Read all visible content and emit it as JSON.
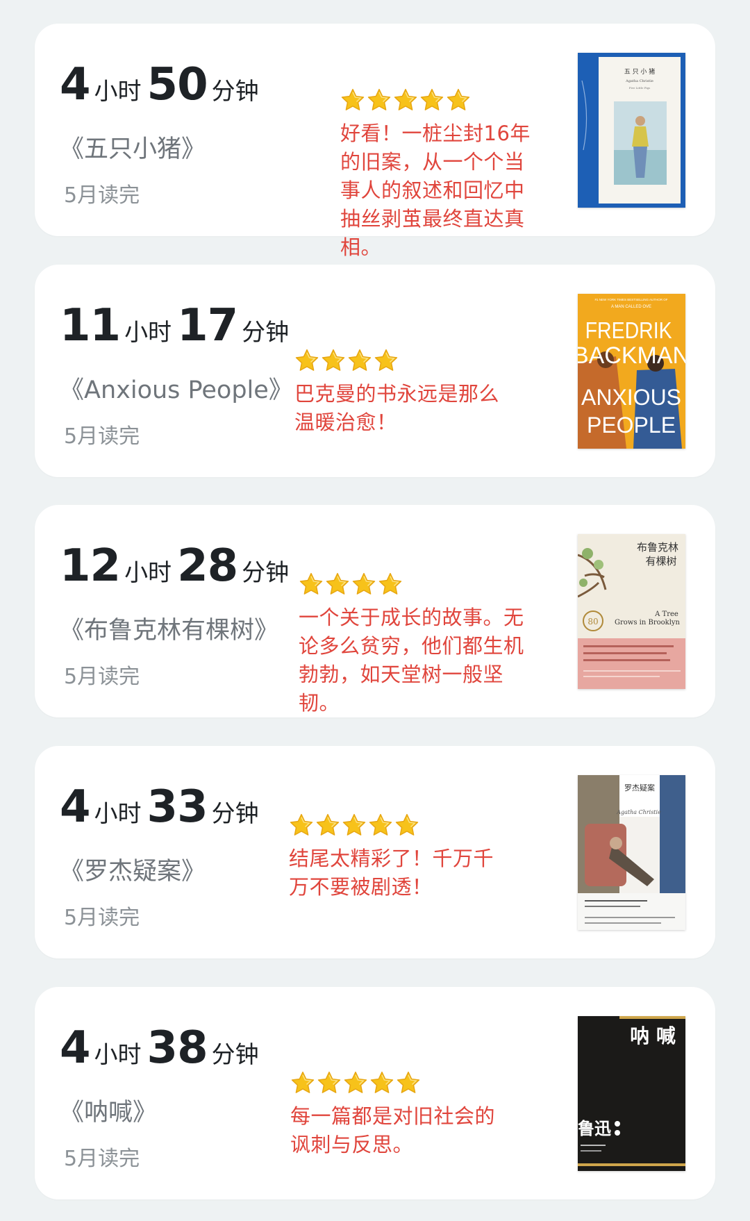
{
  "books": [
    {
      "hours": "4",
      "minutes": "50",
      "hour_unit": "小时",
      "minute_unit": "分钟",
      "title": "《五只小猪》",
      "status": "5月读完",
      "stars": 5,
      "comment": "好看！一桩尘封16年的旧案，从一个个当事人的叙述和回忆中抽丝剥茧最终直达真相。",
      "cover_icon": "book-cover-five-little-pigs"
    },
    {
      "hours": "11",
      "minutes": "17",
      "hour_unit": "小时",
      "minute_unit": "分钟",
      "title": "《Anxious People》",
      "status": "5月读完",
      "stars": 4,
      "comment": "巴克曼的书永远是那么温暖治愈！",
      "cover_icon": "book-cover-anxious-people"
    },
    {
      "hours": "12",
      "minutes": "28",
      "hour_unit": "小时",
      "minute_unit": "分钟",
      "title": "《布鲁克林有棵树》",
      "status": "5月读完",
      "stars": 4,
      "comment": "一个关于成长的故事。无论多么贫穷，他们都生机勃勃，如天堂树一般坚韧。",
      "cover_icon": "book-cover-a-tree-grows-in-brooklyn"
    },
    {
      "hours": "4",
      "minutes": "33",
      "hour_unit": "小时",
      "minute_unit": "分钟",
      "title": "《罗杰疑案》",
      "status": "5月读完",
      "stars": 5,
      "comment": "结尾太精彩了！千万千万不要被剧透！",
      "cover_icon": "book-cover-roger-ackroyd"
    },
    {
      "hours": "4",
      "minutes": "38",
      "hour_unit": "小时",
      "minute_unit": "分钟",
      "title": "《呐喊》",
      "status": "5月读完",
      "stars": 5,
      "comment": "每一篇都是对旧社会的讽刺与反思。",
      "cover_icon": "book-cover-call-to-arms"
    }
  ],
  "covers": {
    "c0": {
      "top_line": "五 只 小 猪",
      "author": "Agatha Christie",
      "sub": "Five Little Pigs"
    },
    "c1": {
      "tag": "#1 NEW YORK TIMES BESTSELLING AUTHOR OF",
      "tag2": "A MAN CALLED OVE",
      "author1": "FREDRIK",
      "author2": "BACKMAN",
      "title1": "ANXIOUS",
      "title2": "PEOPLE"
    },
    "c2": {
      "title1": "布鲁克林",
      "title2": "有棵树",
      "en1": "A Tree",
      "en2": "Grows in Brooklyn",
      "badge": "80"
    },
    "c3": {
      "title": "罗杰疑案",
      "sign": "Agatha Christie"
    },
    "c4": {
      "title": "呐 喊",
      "author": "鲁迅"
    }
  },
  "colors": {
    "accent_red": "#e0453c",
    "star_yellow": "#f7c21a",
    "page_bg": "#eef2f3"
  }
}
